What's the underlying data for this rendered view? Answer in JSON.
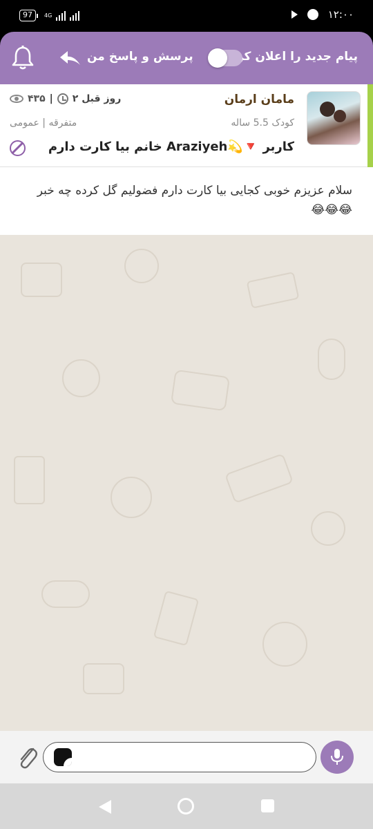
{
  "status_bar": {
    "battery": "97",
    "network": "4G",
    "time": "۱۲:۰۰"
  },
  "header": {
    "notify_label": "پیام جدید را اعلان کن",
    "qa_label": "پرسش و پاسخ من",
    "notify_enabled": false,
    "accent_color": "#9c7bb8"
  },
  "post": {
    "author": "مامان ارمان",
    "child_age": "کودک 5.5 ساله",
    "subject": "کاربر 🔻💫Araziyeh خانم بیا کارت دارم",
    "views": "۴۳۵",
    "separator": "|",
    "time_ago": "۲ روز قبل",
    "category": "متفرقه | عمومی",
    "body": "سلام عزیزم خوبی کجایی بیا کارت دارم فضولیم گل کرده چه خبر 😂😂😂",
    "accent_color": "#a6d14a"
  },
  "composer": {
    "value": "",
    "placeholder": ""
  },
  "icons": {
    "bell": "bell-icon",
    "back": "back-arrow-icon",
    "eye": "eye-icon",
    "clock": "clock-icon",
    "block": "block-icon",
    "attach": "paperclip-icon",
    "sticker": "sticker-icon",
    "mic": "mic-icon"
  }
}
